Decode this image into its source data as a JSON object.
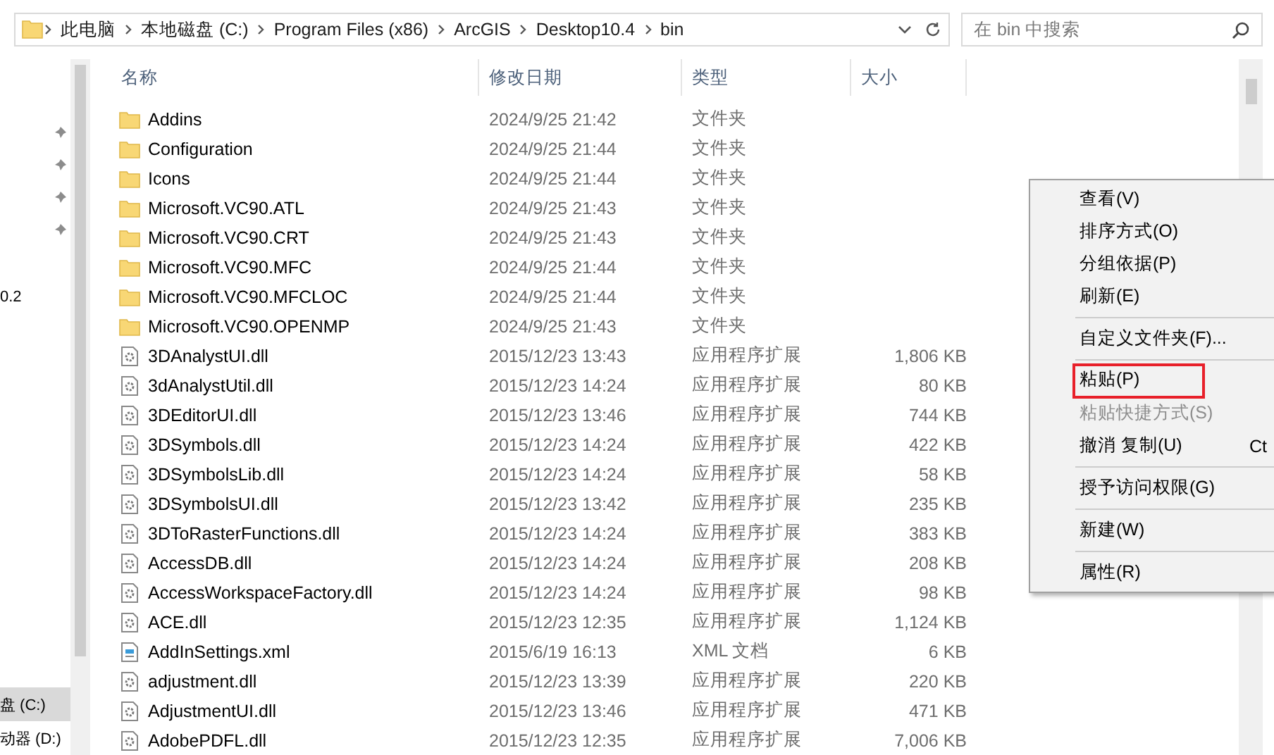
{
  "address_bar": {
    "crumbs": [
      "此电脑",
      "本地磁盘 (C:)",
      "Program Files (x86)",
      "ArcGIS",
      "Desktop10.4",
      "bin"
    ]
  },
  "search": {
    "placeholder": "在 bin 中搜索"
  },
  "sidebar": {
    "items": [
      {
        "kind": "pinned"
      },
      {
        "kind": "pinned"
      },
      {
        "kind": "pinned"
      },
      {
        "kind": "pinned"
      },
      {
        "kind": "text",
        "label": "0.2",
        "selected": false
      },
      {
        "kind": "drive",
        "label": "盘 (C:)",
        "selected": true
      },
      {
        "kind": "drive",
        "label": "动器 (D:)",
        "selected": false
      }
    ]
  },
  "table": {
    "columns": [
      "名称",
      "修改日期",
      "类型",
      "大小"
    ],
    "rows": [
      {
        "kind": "folder",
        "name": "Addins",
        "date": "2024/9/25 21:42",
        "type": "文件夹"
      },
      {
        "kind": "folder",
        "name": "Configuration",
        "date": "2024/9/25 21:44",
        "type": "文件夹"
      },
      {
        "kind": "folder",
        "name": "Icons",
        "date": "2024/9/25 21:44",
        "type": "文件夹"
      },
      {
        "kind": "folder",
        "name": "Microsoft.VC90.ATL",
        "date": "2024/9/25 21:43",
        "type": "文件夹"
      },
      {
        "kind": "folder",
        "name": "Microsoft.VC90.CRT",
        "date": "2024/9/25 21:43",
        "type": "文件夹"
      },
      {
        "kind": "folder",
        "name": "Microsoft.VC90.MFC",
        "date": "2024/9/25 21:44",
        "type": "文件夹"
      },
      {
        "kind": "folder",
        "name": "Microsoft.VC90.MFCLOC",
        "date": "2024/9/25 21:44",
        "type": "文件夹"
      },
      {
        "kind": "folder",
        "name": "Microsoft.VC90.OPENMP",
        "date": "2024/9/25 21:43",
        "type": "文件夹"
      },
      {
        "kind": "dll",
        "name": "3DAnalystUI.dll",
        "date": "2015/12/23 13:43",
        "type": "应用程序扩展",
        "size": "1,806 KB"
      },
      {
        "kind": "dll",
        "name": "3dAnalystUtil.dll",
        "date": "2015/12/23 14:24",
        "type": "应用程序扩展",
        "size": "80 KB"
      },
      {
        "kind": "dll",
        "name": "3DEditorUI.dll",
        "date": "2015/12/23 13:46",
        "type": "应用程序扩展",
        "size": "744 KB"
      },
      {
        "kind": "dll",
        "name": "3DSymbols.dll",
        "date": "2015/12/23 14:24",
        "type": "应用程序扩展",
        "size": "422 KB"
      },
      {
        "kind": "dll",
        "name": "3DSymbolsLib.dll",
        "date": "2015/12/23 14:24",
        "type": "应用程序扩展",
        "size": "58 KB"
      },
      {
        "kind": "dll",
        "name": "3DSymbolsUI.dll",
        "date": "2015/12/23 13:42",
        "type": "应用程序扩展",
        "size": "235 KB"
      },
      {
        "kind": "dll",
        "name": "3DToRasterFunctions.dll",
        "date": "2015/12/23 14:24",
        "type": "应用程序扩展",
        "size": "383 KB"
      },
      {
        "kind": "dll",
        "name": "AccessDB.dll",
        "date": "2015/12/23 14:24",
        "type": "应用程序扩展",
        "size": "208 KB"
      },
      {
        "kind": "dll",
        "name": "AccessWorkspaceFactory.dll",
        "date": "2015/12/23 14:24",
        "type": "应用程序扩展",
        "size": "98 KB"
      },
      {
        "kind": "dll",
        "name": "ACE.dll",
        "date": "2015/12/23 12:35",
        "type": "应用程序扩展",
        "size": "1,124 KB"
      },
      {
        "kind": "xml",
        "name": "AddInSettings.xml",
        "date": "2015/6/19 16:13",
        "type": "XML 文档",
        "size": "6 KB"
      },
      {
        "kind": "dll",
        "name": "adjustment.dll",
        "date": "2015/12/23 13:39",
        "type": "应用程序扩展",
        "size": "220 KB"
      },
      {
        "kind": "dll",
        "name": "AdjustmentUI.dll",
        "date": "2015/12/23 13:46",
        "type": "应用程序扩展",
        "size": "471 KB"
      },
      {
        "kind": "dll",
        "name": "AdobePDFL.dll",
        "date": "2015/12/23 12:35",
        "type": "应用程序扩展",
        "size": "7,006 KB"
      }
    ]
  },
  "context_menu": {
    "items": [
      {
        "kind": "item",
        "label": "查看(V)",
        "disabled": false,
        "outlined": false
      },
      {
        "kind": "item",
        "label": "排序方式(O)",
        "disabled": false,
        "outlined": false
      },
      {
        "kind": "item",
        "label": "分组依据(P)",
        "disabled": false,
        "outlined": false
      },
      {
        "kind": "item",
        "label": "刷新(E)",
        "disabled": false,
        "outlined": false
      },
      {
        "kind": "separator"
      },
      {
        "kind": "item",
        "label": "自定义文件夹(F)...",
        "disabled": false,
        "outlined": false
      },
      {
        "kind": "separator"
      },
      {
        "kind": "item",
        "label": "粘贴(P)",
        "disabled": false,
        "outlined": true
      },
      {
        "kind": "item",
        "label": "粘贴快捷方式(S)",
        "disabled": true,
        "outlined": false
      },
      {
        "kind": "item",
        "label": "撤消 复制(U)",
        "shortcut": "Ct",
        "disabled": false,
        "outlined": false
      },
      {
        "kind": "separator"
      },
      {
        "kind": "item",
        "label": "授予访问权限(G)",
        "disabled": false,
        "outlined": false
      },
      {
        "kind": "separator"
      },
      {
        "kind": "item",
        "label": "新建(W)",
        "disabled": false,
        "outlined": false
      },
      {
        "kind": "separator"
      },
      {
        "kind": "item",
        "label": "属性(R)",
        "disabled": false,
        "outlined": false
      }
    ]
  }
}
